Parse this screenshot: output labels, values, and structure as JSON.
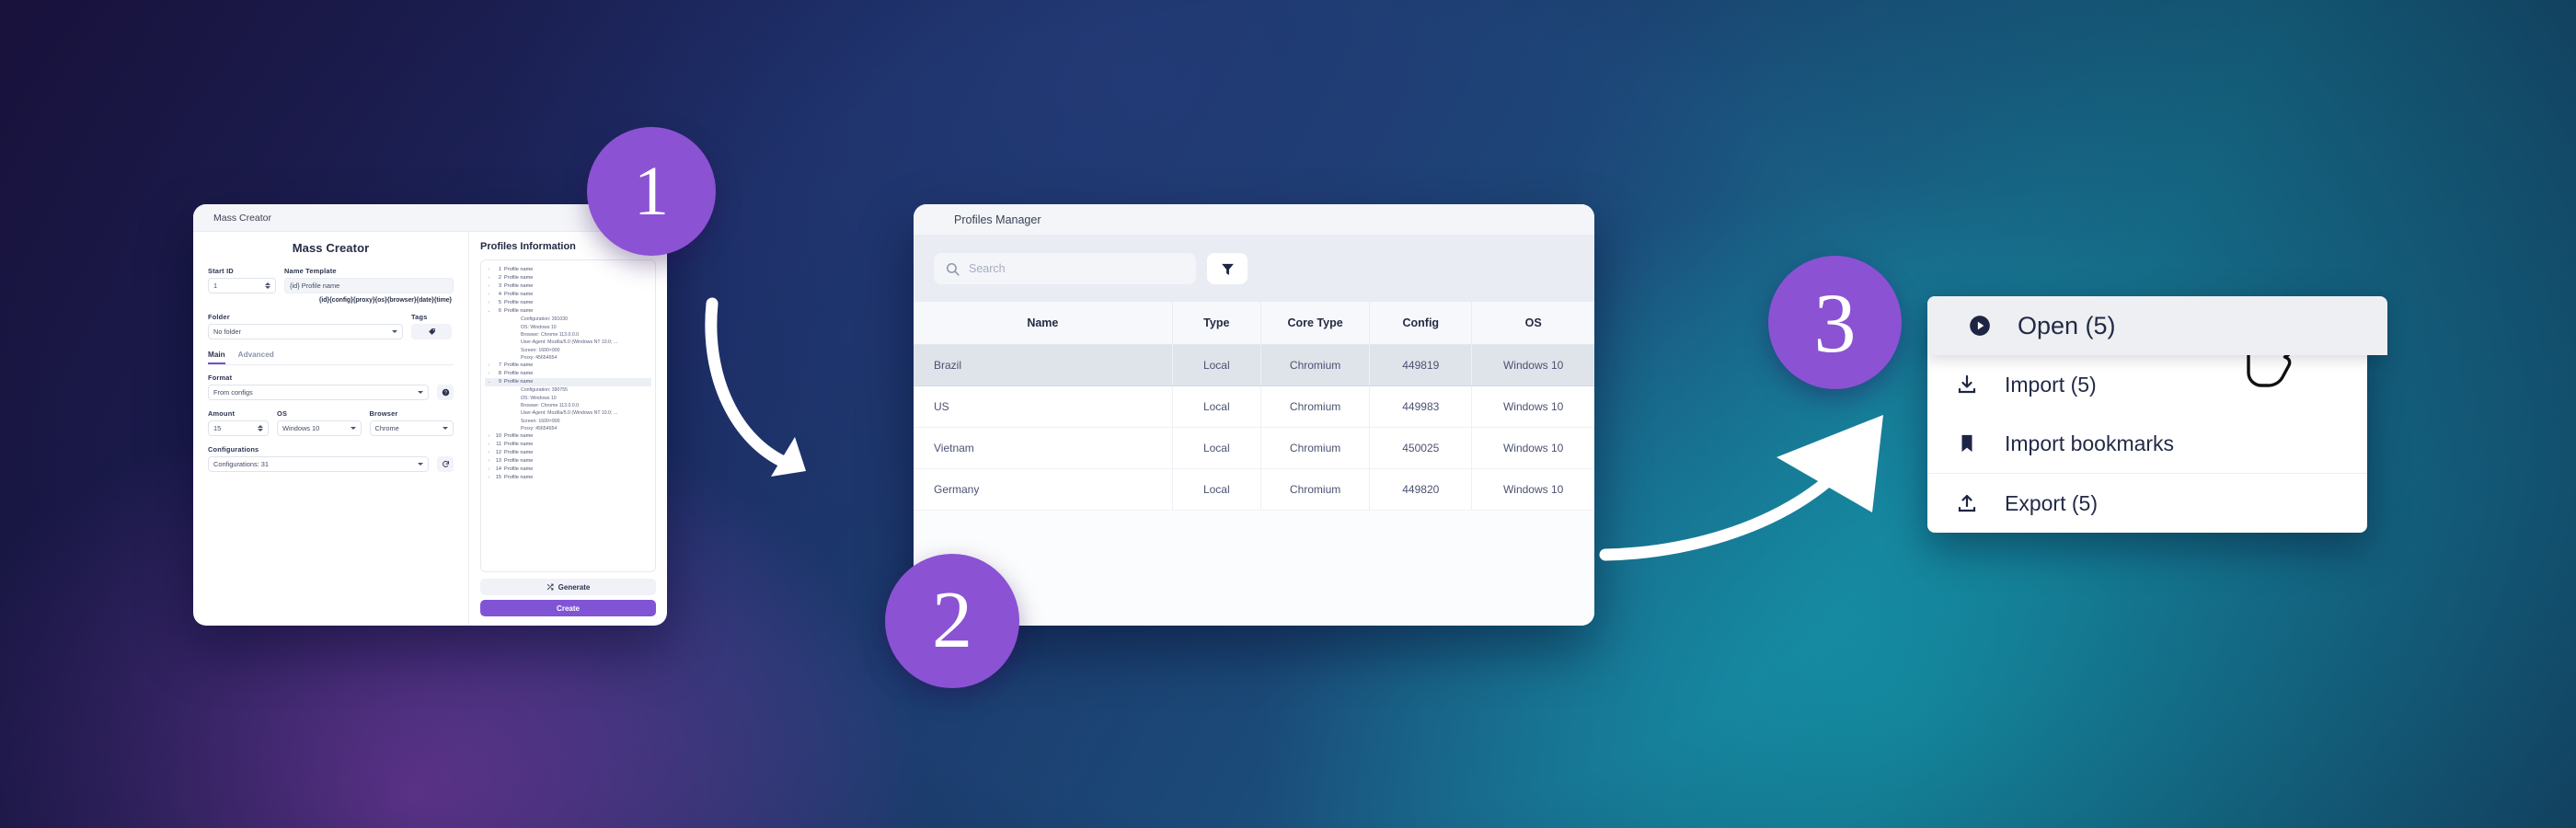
{
  "theme": {
    "accent_purple": "#8b52d4",
    "create_button_purple": "#8154d6",
    "text_dark": "#252b45",
    "muted_text": "#a7adc0"
  },
  "mass_creator": {
    "window_title": "Mass Creator",
    "heading": "Mass Creator",
    "fields": {
      "start_id_label": "Start ID",
      "start_id_value": "1",
      "name_template_label": "Name Template",
      "name_template_value": "{id} Profile name",
      "template_tokens": "{id}{config}{proxy}{os}{browser}{date}{time}",
      "folder_label": "Folder",
      "folder_value": "No folder",
      "tags_label": "Tags",
      "format_label": "Format",
      "format_value": "From configs",
      "amount_label": "Amount",
      "amount_value": "15",
      "os_label": "OS",
      "os_value": "Windows 10",
      "browser_label": "Browser",
      "browser_value": "Chrome",
      "configurations_label": "Configurations",
      "configurations_value": "Configurations: 31"
    },
    "tabs": [
      {
        "label": "Main",
        "active": true
      },
      {
        "label": "Advanced",
        "active": false
      }
    ]
  },
  "profiles_information": {
    "title": "Profiles Information",
    "rows": [
      {
        "num": "1",
        "name": "Profile name",
        "expanded": false,
        "selected": false
      },
      {
        "num": "2",
        "name": "Profile name",
        "expanded": false,
        "selected": false
      },
      {
        "num": "3",
        "name": "Profile name",
        "expanded": false,
        "selected": false
      },
      {
        "num": "4",
        "name": "Profile name",
        "expanded": false,
        "selected": false
      },
      {
        "num": "5",
        "name": "Profile name",
        "expanded": false,
        "selected": false
      },
      {
        "num": "6",
        "name": "Profile name",
        "expanded": true,
        "selected": false,
        "details": [
          "Configuration: 391030",
          "OS: Windows 10",
          "Browser: Chrome 113.0.0.0",
          "User-Agent: Mozilla/5.0 (Windows NT 10.0; ...",
          "Screen: 1600×900",
          "Proxy: 45654654"
        ]
      },
      {
        "num": "7",
        "name": "Profile name",
        "expanded": false,
        "selected": false
      },
      {
        "num": "8",
        "name": "Profile name",
        "expanded": false,
        "selected": false
      },
      {
        "num": "9",
        "name": "Profile name",
        "expanded": true,
        "selected": true,
        "details": [
          "Configuration: 390755",
          "OS: Windows 10",
          "Browser: Chrome 113.0.0.0",
          "User-Agent: Mozilla/5.0 (Windows NT 10.0; ...",
          "Screen: 1600×900",
          "Proxy: 45654654"
        ]
      },
      {
        "num": "10",
        "name": "Profile name",
        "expanded": false,
        "selected": false
      },
      {
        "num": "11",
        "name": "Profile name",
        "expanded": false,
        "selected": false
      },
      {
        "num": "12",
        "name": "Profile name",
        "expanded": false,
        "selected": false
      },
      {
        "num": "13",
        "name": "Profile name",
        "expanded": false,
        "selected": false
      },
      {
        "num": "14",
        "name": "Profile name",
        "expanded": false,
        "selected": false
      },
      {
        "num": "15",
        "name": "Profile name",
        "expanded": false,
        "selected": false
      }
    ],
    "generate_label": "Generate",
    "create_label": "Create"
  },
  "profiles_manager": {
    "window_title": "Profiles Manager",
    "search_placeholder": "Search",
    "search_value": "",
    "columns": [
      "Name",
      "Type",
      "Core Type",
      "Config",
      "OS"
    ],
    "rows": [
      {
        "name": "Brazil",
        "type": "Local",
        "core_type": "Chromium",
        "config": "449819",
        "os": "Windows 10",
        "selected": true
      },
      {
        "name": "US",
        "type": "Local",
        "core_type": "Chromium",
        "config": "449983",
        "os": "Windows 10",
        "selected": false
      },
      {
        "name": "Vietnam",
        "type": "Local",
        "core_type": "Chromium",
        "config": "450025",
        "os": "Windows 10",
        "selected": false
      },
      {
        "name": "Germany",
        "type": "Local",
        "core_type": "Chromium",
        "config": "449820",
        "os": "Windows 10",
        "selected": false
      }
    ]
  },
  "context_menu": {
    "items": [
      {
        "label": "Open (5)",
        "icon": "play-circle-icon",
        "highlighted": true
      },
      {
        "label": "Import (5)",
        "icon": "download-icon",
        "highlighted": false
      },
      {
        "label": "Import bookmarks",
        "icon": "bookmark-icon",
        "highlighted": false
      },
      {
        "label": "Export (5)",
        "icon": "upload-icon",
        "highlighted": false
      }
    ]
  },
  "steps": [
    {
      "number": "1"
    },
    {
      "number": "2"
    },
    {
      "number": "3"
    }
  ]
}
